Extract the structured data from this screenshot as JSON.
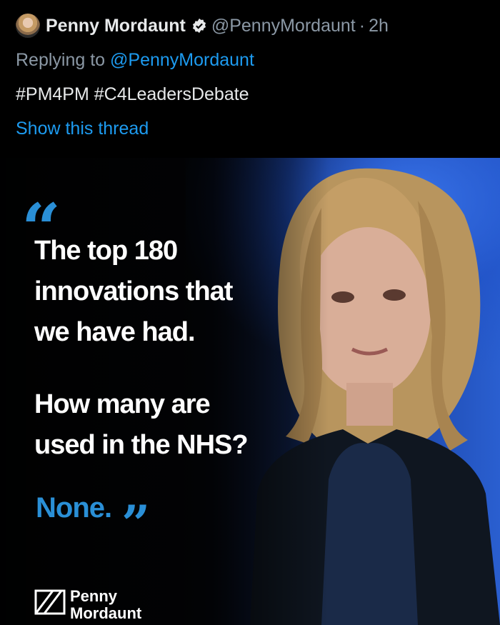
{
  "tweet": {
    "author_name": "Penny Mordaunt",
    "author_handle": "@PennyMordaunt",
    "separator": "·",
    "time": "2h",
    "replying_prefix": "Replying to",
    "replying_to": "@PennyMordaunt",
    "hashtags": "#PM4PM #C4LeadersDebate",
    "show_thread": "Show this thread"
  },
  "media": {
    "quote_line1": "The top 180",
    "quote_line2": "innovations that",
    "quote_line3": "we have had.",
    "question_line1": "How many are",
    "question_line2": "used in the NHS?",
    "answer": "None.",
    "brand_line1": "Penny",
    "brand_line2": "Mordaunt"
  },
  "colors": {
    "link_blue": "#1d9bf0",
    "quote_blue": "#2a8fd6",
    "background": "#000000"
  },
  "icons": {
    "verified": "verified-badge-icon",
    "open_quote": "open-quote-icon",
    "close_quote": "close-quote-icon",
    "brand_logo": "pm-logo-icon"
  }
}
